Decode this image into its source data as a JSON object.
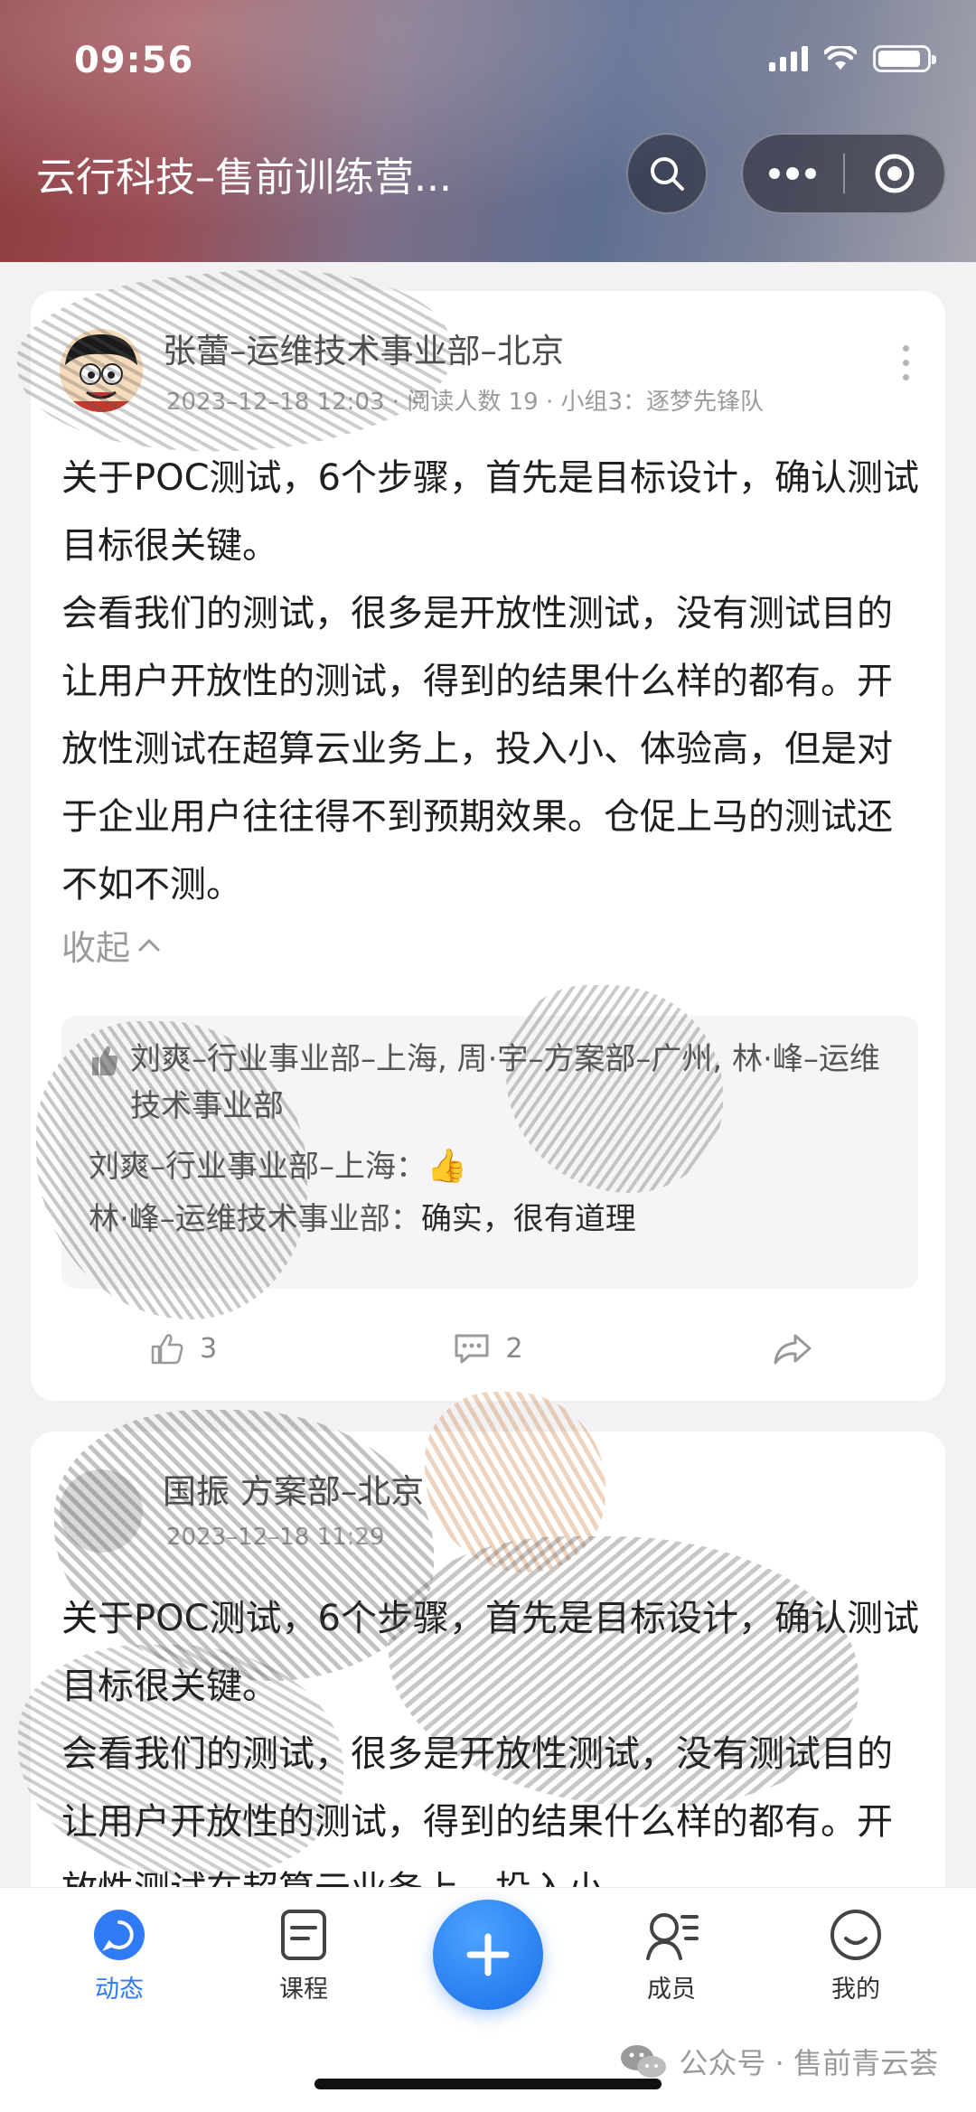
{
  "status_bar": {
    "time": "09:56"
  },
  "header": {
    "title": "云行科技–售前训练营...",
    "search_icon": "search-icon",
    "menu_icon": "more-horizontal-icon",
    "close_icon": "target-circle-icon"
  },
  "posts": [
    {
      "author": "张蕾–运维技术事业部–北京",
      "date": "2023–12–18 12:03",
      "views": "阅读人数 19",
      "group": "小组3：逐梦先锋队",
      "paragraphs": [
        "关于POC测试，6个步骤，首先是目标设计，确认测试目标很关键。",
        "会看我们的测试，很多是开放性测试，没有测试目的让用户开放性的测试，得到的结果什么样的都有。开放性测试在超算云业务上，投入小、体验高，但是对于企业用户往往得不到预期效果。仓促上马的测试还不如不测。"
      ],
      "collapse_label": "收起",
      "likes_text": "刘爽–行业事业部–上海, 周·宇–方案部–广州, 林·峰–运维技术事业部",
      "comments": [
        {
          "author": "刘爽–行业事业部–上海：",
          "text": "👍"
        },
        {
          "author": "林·峰–运维技术事业部：",
          "text": "确实，很有道理"
        }
      ],
      "like_count": "3",
      "comment_count": "2"
    },
    {
      "author": "国振 方案部–北京",
      "date": "2023–12–18 11:29",
      "paragraphs": [
        "关于POC测试，6个步骤，首先是目标设计，确认测试目标很关键。",
        "会看我们的测试，很多是开放性测试，没有测试目的让用户开放性的测试，得到的结果什么样的都有。开放性测试在超算云业务上，投入小、"
      ]
    }
  ],
  "tabs": [
    {
      "label": "动态",
      "icon": "chat-bubble-icon",
      "active": true
    },
    {
      "label": "课程",
      "icon": "course-book-icon",
      "active": false
    },
    {
      "label": "成员",
      "icon": "members-icon",
      "active": false
    },
    {
      "label": "我的",
      "icon": "smile-face-icon",
      "active": false
    }
  ],
  "watermark": "公众号 · 售前青云荟",
  "colors": {
    "accent": "#2f7bf5",
    "text": "#1f1f1f",
    "muted": "#9b9b9b"
  }
}
